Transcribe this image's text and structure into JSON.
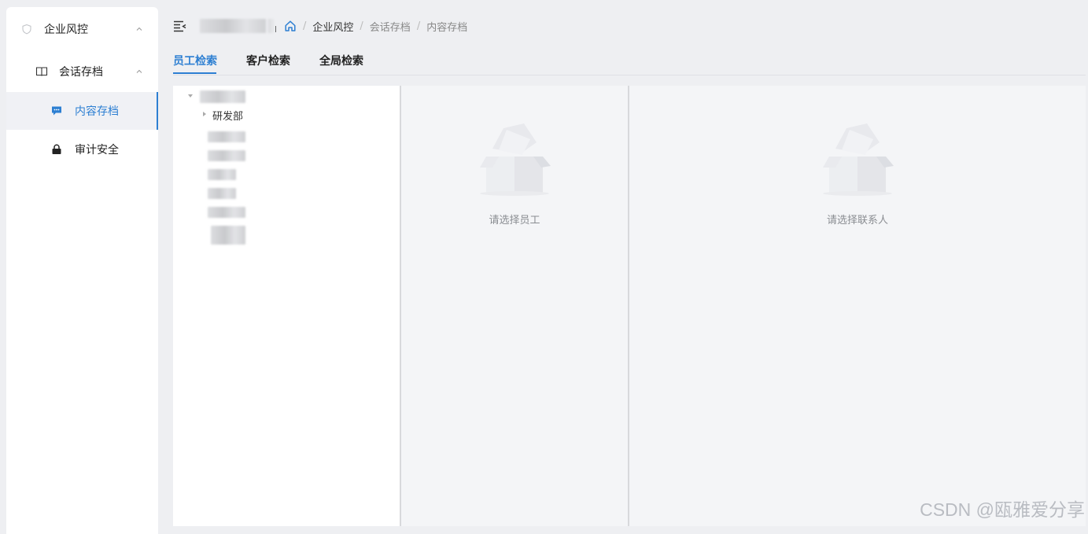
{
  "sidebar": {
    "items": [
      {
        "label": "企业风控",
        "icon": "shield-icon",
        "expanded": true
      },
      {
        "label": "会话存档",
        "icon": "book-icon",
        "expanded": true
      },
      {
        "label": "内容存档",
        "icon": "chat-icon",
        "active": true
      },
      {
        "label": "审计安全",
        "icon": "lock-icon"
      }
    ],
    "accent_color": "#2d7fd2"
  },
  "header": {
    "menu_icon": "menu-fold-icon",
    "home_icon": "home-icon",
    "breadcrumb": [
      "企业风控",
      "会话存档",
      "内容存档"
    ],
    "separator": "/"
  },
  "tabs": [
    {
      "label": "员工检索",
      "active": true
    },
    {
      "label": "客户检索"
    },
    {
      "label": "全局检索"
    }
  ],
  "tree": {
    "child_label": "研发部"
  },
  "panels": {
    "employee_empty_text": "请选择员工",
    "contact_empty_text": "请选择联系人"
  },
  "watermark": "CSDN @瓯雅爱分享"
}
